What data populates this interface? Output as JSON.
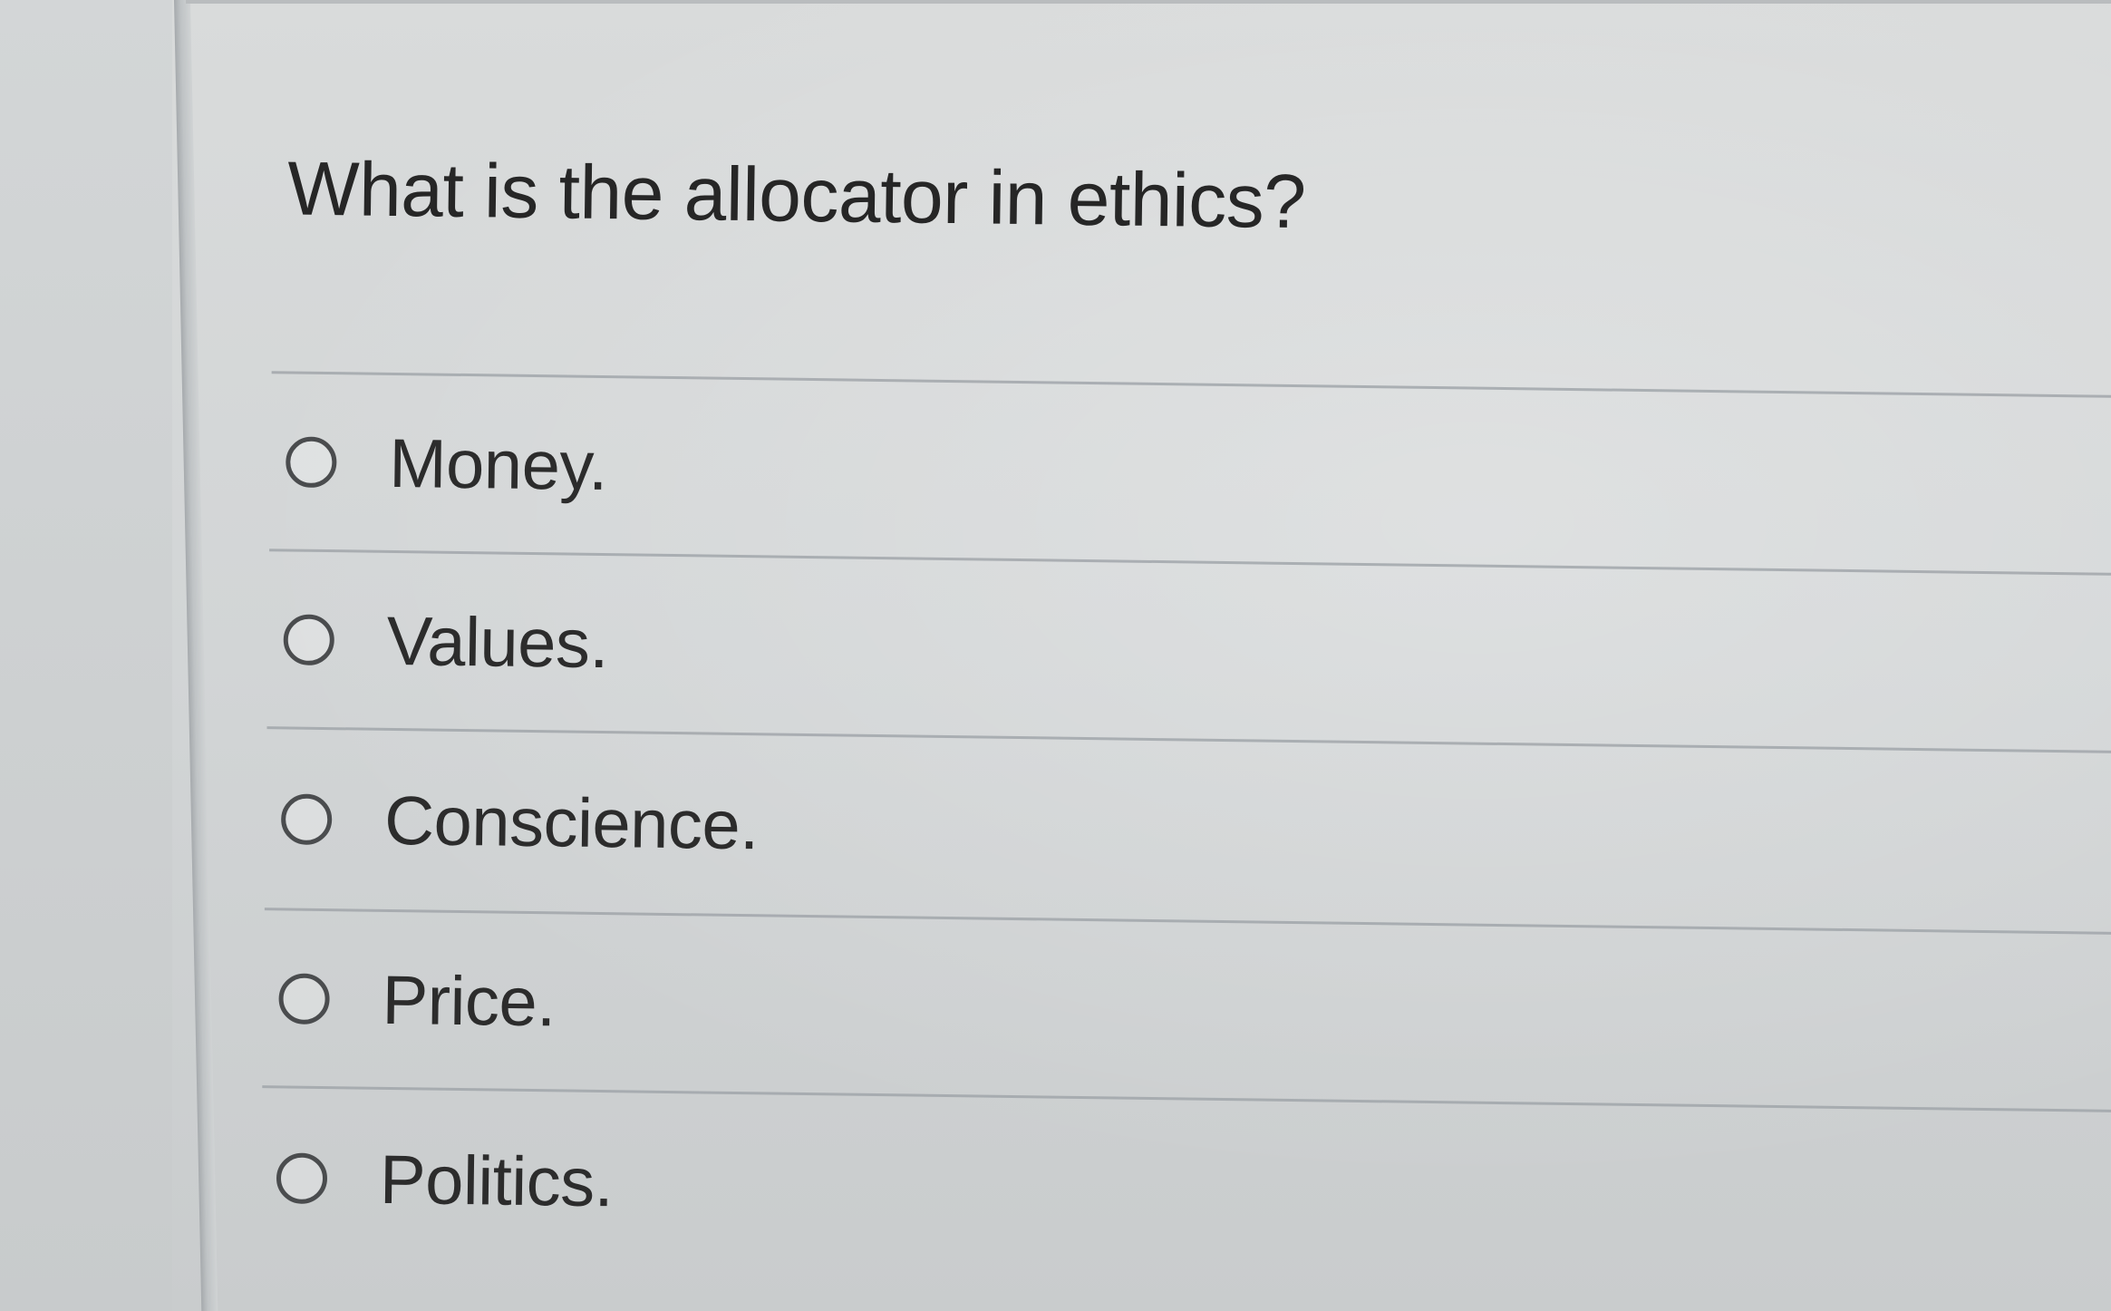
{
  "question": {
    "text": "What is the allocator in ethics?"
  },
  "options": [
    {
      "label": "Money.",
      "selected": false
    },
    {
      "label": "Values.",
      "selected": false
    },
    {
      "label": "Conscience.",
      "selected": false
    },
    {
      "label": "Price.",
      "selected": false
    },
    {
      "label": "Politics.",
      "selected": false
    }
  ],
  "colors": {
    "background": "#d3d6d7",
    "text": "#2a2a2a",
    "radio_border": "#4a4c4e",
    "divider": "#9ea3a8"
  }
}
